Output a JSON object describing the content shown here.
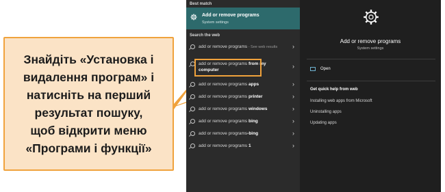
{
  "callout": {
    "text": "Знайдіть «Установка і\nвидалення програм» і\nнатисніть на перший\nрезультат пошуку,\nщоб відкрити меню\n«Програми і функції»"
  },
  "search": {
    "best_match_label": "Best match",
    "best_match": {
      "title": "Add or remove programs",
      "subtitle": "System settings"
    },
    "web_label": "Search the web",
    "web_results": [
      {
        "query": "add or remove programs",
        "suffix": " - See web results",
        "bold": ""
      },
      {
        "query": "add or remove programs ",
        "suffix": "",
        "bold": "from my computer"
      },
      {
        "query": "add or remove programs ",
        "suffix": "",
        "bold": "apps"
      },
      {
        "query": "add or remove programs ",
        "suffix": "",
        "bold": "printer"
      },
      {
        "query": "add or remove programs ",
        "suffix": "",
        "bold": "windows"
      },
      {
        "query": "add or remove programs ",
        "suffix": "",
        "bold": "bing"
      },
      {
        "query": "add or remove programs",
        "suffix": "",
        "bold": "-bing"
      },
      {
        "query": "add or remove programs ",
        "suffix": "",
        "bold": "1"
      }
    ]
  },
  "details": {
    "title": "Add or remove programs",
    "subtitle": "System settings",
    "open_label": "Open",
    "help_title": "Get quick help from web",
    "help_links": [
      "Installing web apps from Microsoft",
      "Uninstalling apps",
      "Updating apps"
    ]
  },
  "colors": {
    "accent_orange": "#f0a23c",
    "callout_bg": "#fbe3c6",
    "best_match_bg": "#2d6a6c"
  },
  "icons": {
    "best_match": "gear-icon",
    "web_result": "search-icon",
    "open": "open-window-icon",
    "chevron": "chevron-right-icon"
  }
}
